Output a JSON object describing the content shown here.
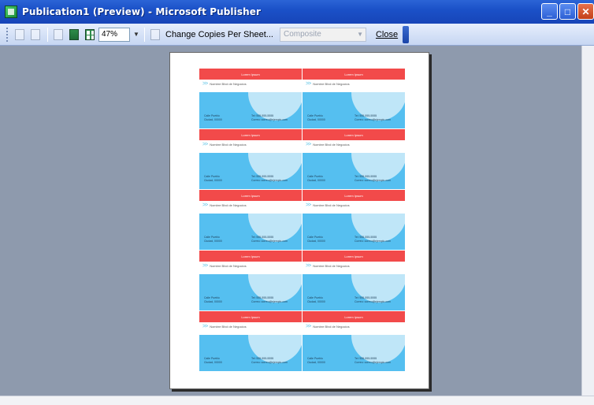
{
  "window": {
    "title": "Publication1 (Preview) - Microsoft Publisher",
    "buttons": [
      "minimize",
      "maximize",
      "close"
    ]
  },
  "toolbar": {
    "zoom_value": "47%",
    "change_copies_label": "Change Copies Per Sheet...",
    "mode_select_value": "Composite",
    "close_label": "Close",
    "icons": [
      "print-preview-icon",
      "print-icon",
      "page-icon",
      "single-page-icon",
      "multi-page-icon",
      "color-icon"
    ]
  },
  "page": {
    "card": {
      "bar_text": "Lorem Ipsum",
      "tagline": "Nombre Blvd de Negocios",
      "address_line1": "Calle Pueblo",
      "address_line2": "Ciudad, 00000",
      "phone_line1": "Tel: 555-555-5555",
      "phone_line2": "Correo: correo@ejemplo.com"
    }
  },
  "colors": {
    "card_red": "#f24a4a",
    "card_blue": "#55bff0",
    "card_arc": "#bfe6f8",
    "workspace_bg": "#8e9aad"
  }
}
